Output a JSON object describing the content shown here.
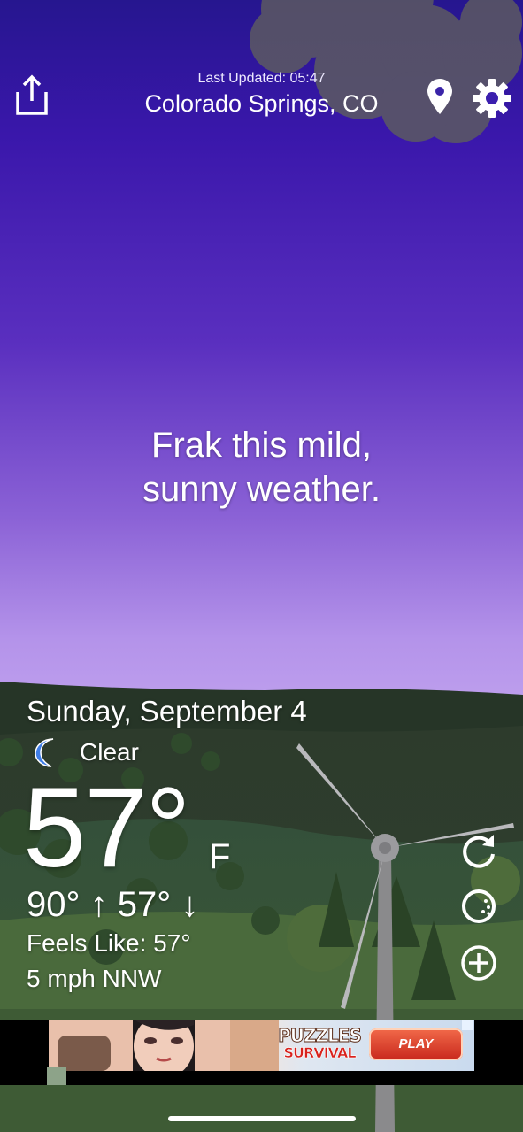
{
  "header": {
    "last_updated": "Last Updated: 05:47",
    "location": "Colorado Springs, CO"
  },
  "icons": {
    "share": "share-icon",
    "location": "location-pin-icon",
    "settings": "gear-icon",
    "condition": "crescent-moon-icon",
    "refresh": "refresh-icon",
    "radar": "radar-icon",
    "add": "plus-circle-icon"
  },
  "slogan": {
    "line1": "Frak this mild,",
    "line2": "sunny weather."
  },
  "weather": {
    "date": "Sunday, September 4",
    "condition": "Clear",
    "temperature": "57°",
    "unit": "F",
    "high_low": "90° ↑ 57° ↓",
    "feels_like": "Feels Like: 57°",
    "wind": "5 mph NNW"
  },
  "ad": {
    "title": "PUZZLES",
    "subtitle": "SURVIVAL",
    "play_label": "PLAY"
  },
  "colors": {
    "sky_top": "#26168f",
    "sky_bottom": "#c6a9f0",
    "grass": "#3f5b3a",
    "moon": "#3f7ee8"
  }
}
